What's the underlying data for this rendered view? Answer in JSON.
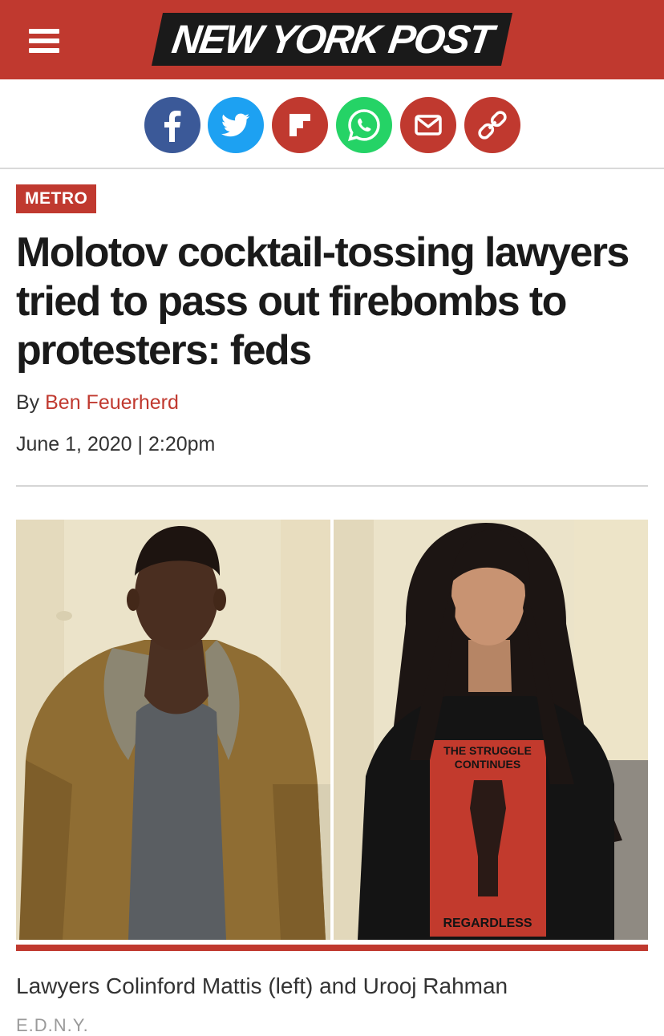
{
  "header": {
    "logo_text": "NEW YORK POST",
    "menu_icon": "hamburger-menu-icon",
    "bg_color": "#c0392f"
  },
  "share_buttons": [
    {
      "name": "facebook",
      "icon": "facebook-icon",
      "color": "#3b5998"
    },
    {
      "name": "twitter",
      "icon": "twitter-icon",
      "color": "#1da1f2"
    },
    {
      "name": "flipboard",
      "icon": "flipboard-icon",
      "color": "#c0392f"
    },
    {
      "name": "whatsapp",
      "icon": "whatsapp-icon",
      "color": "#25d366"
    },
    {
      "name": "email",
      "icon": "email-icon",
      "color": "#c0392f"
    },
    {
      "name": "copy-link",
      "icon": "link-icon",
      "color": "#c0392f"
    }
  ],
  "article": {
    "section": "METRO",
    "headline": "Molotov cocktail-tossing lawyers tried to pass out firebombs to protesters: feds",
    "byline_prefix": "By ",
    "author": "Ben Feuerherd",
    "date": "June 1, 2020",
    "date_separator": " | ",
    "time": "2:20pm",
    "image_caption": "Lawyers Colinford Mattis (left) and Urooj Rahman",
    "image_credit": "E.D.N.Y.",
    "shirt_text_top": "THE STRUGGLE CONTINUES",
    "shirt_text_bottom": "REGARDLESS"
  }
}
